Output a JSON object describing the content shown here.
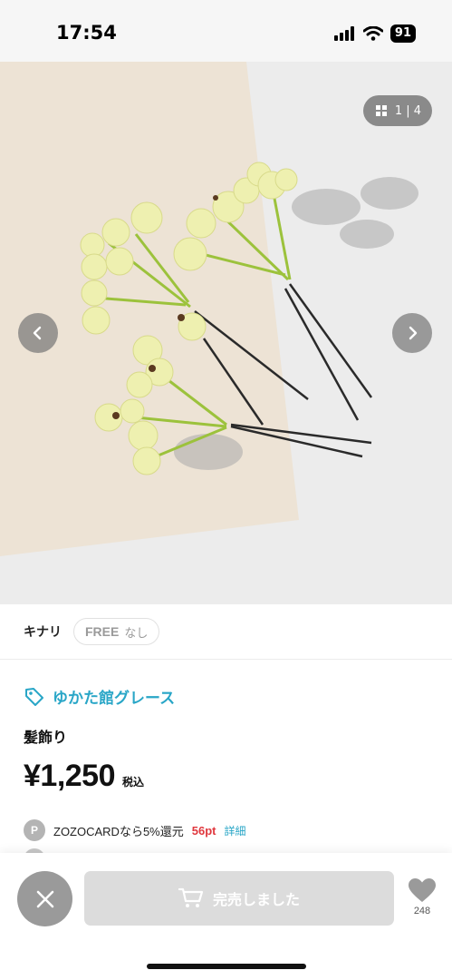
{
  "status_bar": {
    "time": "17:54",
    "battery": "91"
  },
  "gallery": {
    "counter": "1 | 4"
  },
  "variant": {
    "color": "キナリ",
    "size": "FREE",
    "stock": "なし"
  },
  "shop": {
    "name": "ゆかた館グレース"
  },
  "product": {
    "name": "髪飾り",
    "price": "¥1,250",
    "tax_label": "税込"
  },
  "points": {
    "badge": "P",
    "text": "ZOZOCARDなら5%還元",
    "value": "56pt",
    "detail_link": "詳細"
  },
  "action_bar": {
    "soldout_label": "完売しました",
    "favorite_count": "248"
  },
  "icons": [
    "signal-icon",
    "wifi-icon",
    "gallery-grid-icon",
    "chevron-left-icon",
    "chevron-right-icon",
    "tag-icon",
    "close-icon",
    "cart-icon",
    "heart-icon"
  ],
  "colors": {
    "accent": "#29a6c7",
    "points": "#e0383e"
  }
}
